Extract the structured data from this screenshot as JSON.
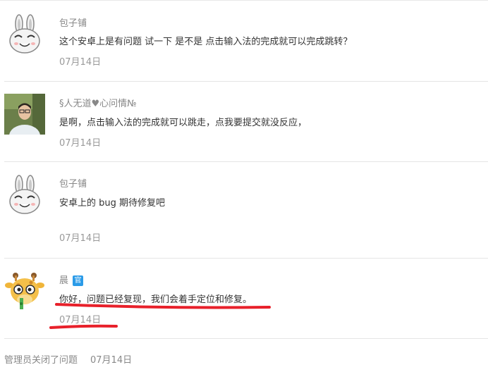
{
  "comments": [
    {
      "author": "包子铺",
      "text": "这个安卓上是有问题 试一下 是不是   点击输入法的完成就可以完成跳转？",
      "date": "07月14日",
      "avatar": "rabbit-avatar"
    },
    {
      "author": "§人无道♥心问情№",
      "text": "是啊，点击输入法的完成就可以跳走，点我要提交就没反应，",
      "date": "07月14日",
      "avatar": "user-photo-avatar"
    },
    {
      "author": "包子铺",
      "text": "安卓上的 bug   期待修复吧",
      "date": "07月14日",
      "avatar": "rabbit-avatar"
    },
    {
      "author": "晨",
      "badge": "官",
      "text": "你好，问题已经复现，我们会着手定位和修复。",
      "date": "07月14日",
      "avatar": "giraffe-avatar"
    }
  ],
  "footer": {
    "action": "管理员关闭了问题",
    "date": "07月14日"
  },
  "colors": {
    "badge": "#2b9be8",
    "annotation": "#e8202a"
  }
}
